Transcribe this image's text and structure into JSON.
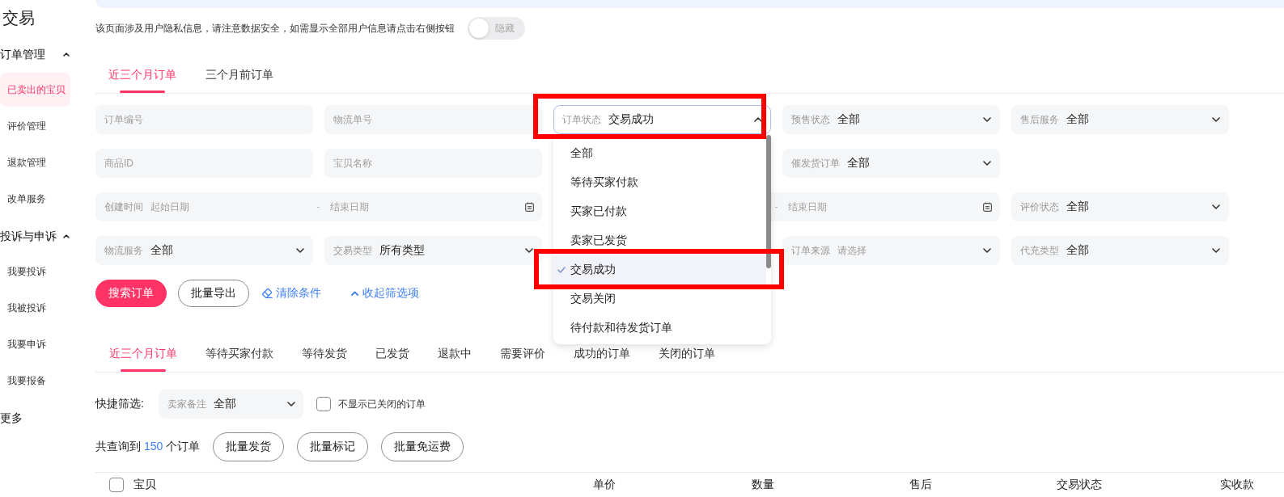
{
  "sidebar": {
    "title": "交易",
    "sections": [
      {
        "label": "订单管理",
        "expanded": true,
        "items": [
          {
            "label": "已卖出的宝贝",
            "selected": true
          },
          {
            "label": "评价管理",
            "selected": false
          },
          {
            "label": "退款管理",
            "selected": false
          },
          {
            "label": "改单服务",
            "selected": false
          }
        ]
      },
      {
        "label": "投诉与申诉",
        "expanded": true,
        "items": [
          {
            "label": "我要投诉",
            "selected": false
          },
          {
            "label": "我被投诉",
            "selected": false
          },
          {
            "label": "我要申诉",
            "selected": false
          },
          {
            "label": "我要报备",
            "selected": false
          }
        ]
      }
    ],
    "more": "更多"
  },
  "privacy_notice": {
    "text": "该页面涉及用户隐私信息，请注意数据安全，如需显示全部用户信息请点击右侧按钮",
    "toggle": {
      "label": "隐藏",
      "on": false
    }
  },
  "period_tabs": [
    {
      "label": "近三个月订单",
      "selected": true
    },
    {
      "label": "三个月前订单",
      "selected": false
    }
  ],
  "filters": [
    [
      {
        "kind": "input",
        "placeholder": "订单编号"
      },
      {
        "kind": "input",
        "placeholder": "物流单号"
      },
      {
        "kind": "select",
        "label": "订单状态",
        "value": "交易成功",
        "open": true,
        "options": [
          {
            "label": "全部",
            "selected": false
          },
          {
            "label": "等待买家付款",
            "selected": false
          },
          {
            "label": "买家已付款",
            "selected": false
          },
          {
            "label": "卖家已发货",
            "selected": false
          },
          {
            "label": "交易成功",
            "selected": true
          },
          {
            "label": "交易关闭",
            "selected": false
          },
          {
            "label": "待付款和待发货订单",
            "selected": false
          }
        ]
      },
      {
        "kind": "select",
        "label": "预售状态",
        "value": "全部",
        "open": false
      },
      {
        "kind": "select",
        "label": "售后服务",
        "value": "全部",
        "open": false
      }
    ],
    [
      {
        "kind": "input",
        "placeholder": "商品ID"
      },
      {
        "kind": "input",
        "placeholder": "宝贝名称"
      },
      {
        "kind": "select",
        "label": "催发货订单",
        "value": "全部",
        "open": false
      }
    ],
    [
      {
        "kind": "date_range",
        "label": "创建时间",
        "start_placeholder": "起始日期",
        "separator": "-",
        "end_placeholder": "结束日期"
      },
      {
        "kind": "date_range",
        "separator": "-",
        "end_placeholder": "结束日期"
      },
      {
        "kind": "select",
        "label": "评价状态",
        "value": "全部",
        "open": false
      }
    ],
    [
      {
        "kind": "select",
        "label": "物流服务",
        "value": "全部",
        "open": false
      },
      {
        "kind": "select",
        "label": "交易类型",
        "value": "所有类型",
        "open": false
      },
      {
        "kind": "select",
        "label": "订单来源",
        "placeholder": "请选择",
        "open": false
      },
      {
        "kind": "select",
        "label": "代充类型",
        "value": "全部",
        "open": false
      }
    ]
  ],
  "filter_actions": [
    {
      "kind": "primary",
      "label": "搜索订单"
    },
    {
      "kind": "outline",
      "label": "批量导出"
    },
    {
      "kind": "clear",
      "label": "清除条件"
    },
    {
      "kind": "collapse",
      "label": "收起筛选项"
    }
  ],
  "status_tabs": [
    {
      "label": "近三个月订单",
      "selected": true
    },
    {
      "label": "等待买家付款",
      "selected": false
    },
    {
      "label": "等待发货",
      "selected": false
    },
    {
      "label": "已发货",
      "selected": false
    },
    {
      "label": "退款中",
      "selected": false
    },
    {
      "label": "需要评价",
      "selected": false
    },
    {
      "label": "成功的订单",
      "selected": false
    },
    {
      "label": "关闭的订单",
      "selected": false
    }
  ],
  "quick_filter": {
    "label": "快捷筛选:",
    "select": {
      "label": "卖家备注",
      "value": "全部"
    },
    "checkbox": {
      "label": "不显示已关闭的订单",
      "checked": false
    }
  },
  "results": {
    "prefix": "共查询到",
    "count": "150",
    "suffix": "个订单",
    "buttons": [
      "批量发货",
      "批量标记",
      "批量免运费"
    ]
  },
  "table": {
    "select_all": {
      "checked": false
    },
    "columns": [
      "宝贝",
      "单价",
      "数量",
      "售后",
      "交易状态",
      "实收款"
    ]
  }
}
